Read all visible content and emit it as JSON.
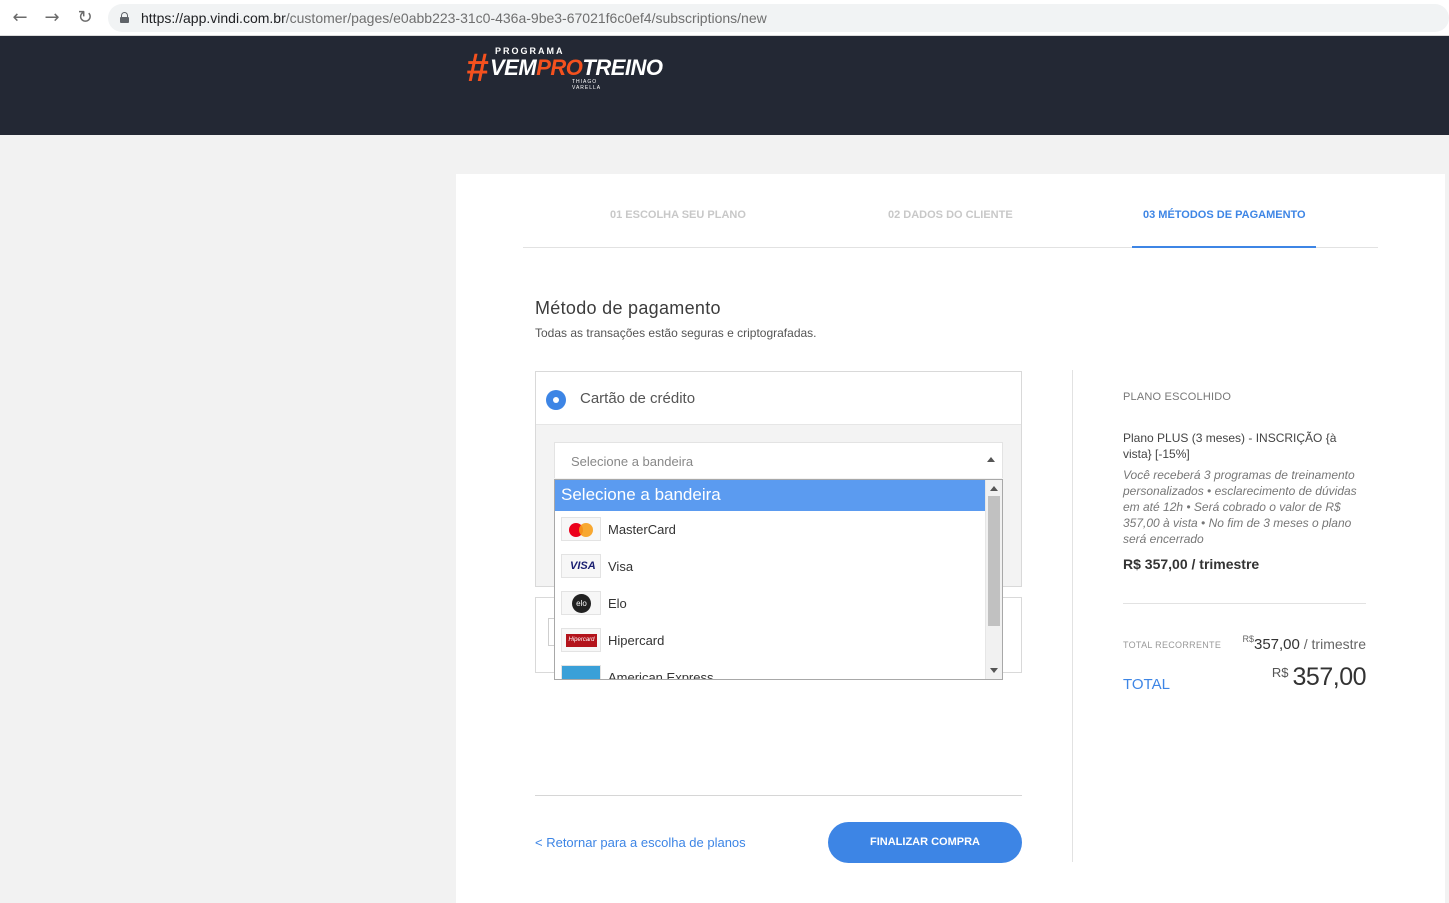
{
  "browser": {
    "back_icon": "arrow-left-icon",
    "forward_icon": "arrow-right-icon",
    "reload_icon": "reload-icon",
    "url_host": "https://app.vindi.com.br",
    "url_path": "/customer/pages/e0abb223-31c0-436a-9be3-67021f6c0ef4/subscriptions/new"
  },
  "header": {
    "logo_hash": "#",
    "logo_top": "PROGRAMA",
    "logo_vem": "VEM",
    "logo_pro": "PRO",
    "logo_treino": "TREINO",
    "logo_sub": "THIAGO VARELLA",
    "colors": {
      "background": "#232834",
      "accent": "#f4511e"
    }
  },
  "steps": [
    {
      "label": "01 ESCOLHA SEU PLANO",
      "active": false
    },
    {
      "label": "02 DADOS DO CLIENTE",
      "active": false
    },
    {
      "label": "03 MÉTODOS DE PAGAMENTO",
      "active": true
    }
  ],
  "payment": {
    "title": "Método de pagamento",
    "subtitle": "Todas as transações estão seguras e criptografadas.",
    "method_label": "Cartão de crédito",
    "select_placeholder": "Selecione a bandeira",
    "dropdown": {
      "header": "Selecione a bandeira",
      "options": [
        {
          "label": "MasterCard",
          "icon": "mastercard-logo"
        },
        {
          "label": "Visa",
          "icon": "visa-logo",
          "logo_text": "VISA"
        },
        {
          "label": "Elo",
          "icon": "elo-logo",
          "logo_text": "elo"
        },
        {
          "label": "Hipercard",
          "icon": "hipercard-logo",
          "logo_text": "Hipercard"
        },
        {
          "label": "American Express",
          "icon": "amex-logo"
        }
      ]
    },
    "back_link": "< Retornar para a escolha de planos",
    "finish_button": "FINALIZAR COMPRA"
  },
  "summary": {
    "label": "PLANO ESCOLHIDO",
    "plan_name": "Plano PLUS (3 meses) - INSCRIÇÃO {à vista} [-15%]",
    "plan_description": "Você receberá 3 programas de treinamento personalizados • esclarecimento de dúvidas em até 12h • Será cobrado o valor de R$ 357,00 à vista • No fim de 3 meses o plano será encerrado",
    "plan_price": "R$ 357,00 / trimestre",
    "recurring_label": "TOTAL RECORRENTE",
    "recurring_currency": "R$",
    "recurring_amount": "357,00",
    "recurring_period": " / trimestre",
    "total_label": "TOTAL",
    "total_currency": "R$",
    "total_amount": "357,00"
  },
  "colors": {
    "primary": "#3d85e5",
    "dropdown_highlight": "#5b9bf0"
  }
}
